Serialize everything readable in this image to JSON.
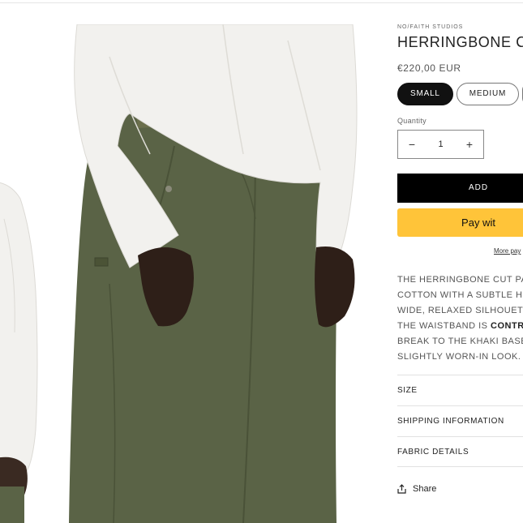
{
  "product": {
    "vendor": "NO/FAITH STUDIOS",
    "title": "HERRINGBONE CUT",
    "price": "€220,00 EUR",
    "sizes": [
      {
        "label": "SMALL",
        "selected": true
      },
      {
        "label": "MEDIUM",
        "selected": false
      },
      {
        "label": "",
        "selected": false
      }
    ],
    "quantity_label": "Quantity",
    "quantity_value": "1",
    "decrease_symbol": "−",
    "increase_symbol": "+",
    "add_to_cart_label": "ADD",
    "pay_label": "Pay wit",
    "more_payment_label": "More pay",
    "description_lines": [
      {
        "text": "THE HERRINGBONE CUT PANT",
        "bold": ""
      },
      {
        "text": "COTTON WITH A SUBTLE HER",
        "bold": ""
      },
      {
        "text": "WIDE, RELAXED SILHOUETTE",
        "bold": ""
      },
      {
        "text": "THE WAISTBAND IS ",
        "bold": "CONTRAS"
      },
      {
        "text": "BREAK TO THE KHAKI BASE. A",
        "bold": ""
      },
      {
        "text": "SLIGHTLY WORN-IN LOOK.",
        "bold": ""
      }
    ],
    "accordion": [
      "SIZE",
      "SHIPPING INFORMATION",
      "FABRIC DETAILS"
    ],
    "share_label": "Share"
  },
  "colors": {
    "button_dark": "#000000",
    "pay_yellow": "#ffc439",
    "pant_olive": "#5a6346",
    "shirt_white": "#f2f1ee"
  },
  "icons": {
    "share": "share-icon"
  }
}
